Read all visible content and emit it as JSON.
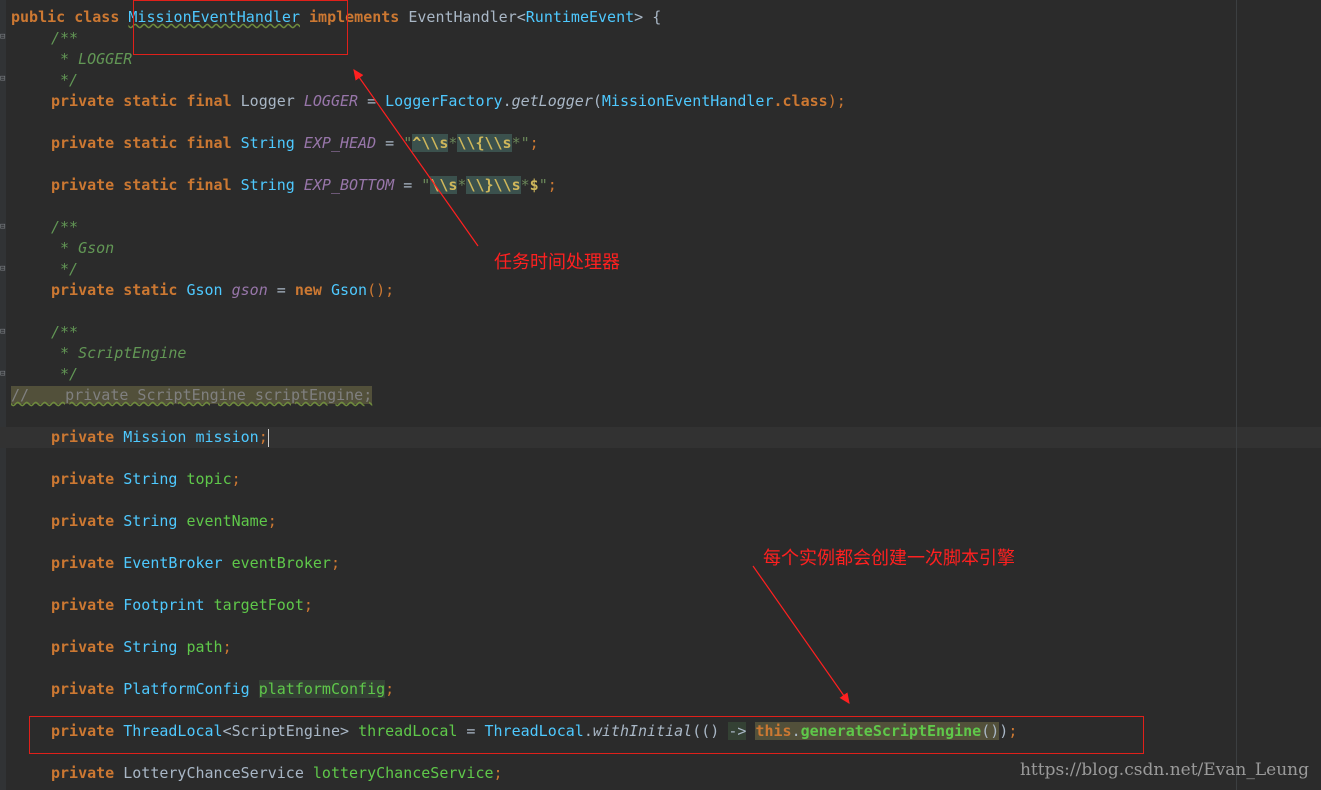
{
  "code": {
    "class_line": {
      "kw": "public class ",
      "name": "MissionEventHandler",
      "mid": " implements ",
      "iface": "EventHandler",
      "lt": "<",
      "generic": "RuntimeEvent",
      "gt": "> {"
    },
    "doc_logger": [
      "/**",
      " * LOGGER",
      " */"
    ],
    "logger_line": {
      "kw": "private static final ",
      "type": "Logger ",
      "field": "LOGGER",
      "eq": " = ",
      "cls": "LoggerFactory",
      "dot": ".",
      "method": "getLogger",
      "open": "(",
      "arg": "MissionEventHandler",
      "suffix": ".class",
      "close": ");"
    },
    "exp_head_line": {
      "kw": "private static final ",
      "type": "String ",
      "field": "EXP_HEAD",
      "eq": " = ",
      "q1": "\"",
      "p1": "^\\\\s",
      "p2": "*",
      "p3": "\\\\{",
      "p4": "\\\\s",
      "p5": "*",
      "q2": "\"",
      "end": ";"
    },
    "exp_bottom_line": {
      "kw": "private static final ",
      "type": "String ",
      "field": "EXP_BOTTOM",
      "eq": " = ",
      "q1": "\"",
      "p1": "\\\\s",
      "p2": "*",
      "p3": "\\\\}",
      "p4": "\\\\s",
      "p5": "*",
      "p6": "$",
      "q2": "\"",
      "end": ";"
    },
    "doc_gson": [
      "/**",
      " * Gson",
      " */"
    ],
    "gson_line": {
      "kw": "private static ",
      "type": "Gson ",
      "field": "gson",
      "eq": " = ",
      "new": "new ",
      "cls": "Gson",
      "end": "();"
    },
    "doc_script": [
      "/**",
      " * ScriptEngine",
      " */"
    ],
    "commented_line": "//    private ScriptEngine scriptEngine;",
    "fields": [
      {
        "kw": "private ",
        "type": "Mission ",
        "name": "mission",
        "end": ";"
      },
      {
        "kw": "private ",
        "type": "String ",
        "name": "topic",
        "end": ";"
      },
      {
        "kw": "private ",
        "type": "String ",
        "name": "eventName",
        "end": ";"
      },
      {
        "kw": "private ",
        "type": "EventBroker ",
        "name": "eventBroker",
        "end": ";"
      },
      {
        "kw": "private ",
        "type": "Footprint ",
        "name": "targetFoot",
        "end": ";"
      },
      {
        "kw": "private ",
        "type": "String ",
        "name": "path",
        "end": ";"
      },
      {
        "kw": "private ",
        "type": "PlatformConfig ",
        "name": "platformConfig",
        "end": ";"
      }
    ],
    "threadlocal_line": {
      "kw": "private ",
      "type": "ThreadLocal",
      "lt": "<",
      "gen": "ScriptEngine",
      "gt": "> ",
      "name": "threadLocal",
      "eq": " = ",
      "cls": "ThreadLocal",
      "dot": ".",
      "method": "withInitial",
      "open": "(() ",
      "arrow": "->",
      "sp": " ",
      "this": "this",
      "dot2": ".",
      "call": "generateScriptEngine",
      "paren": "()",
      "close": ")",
      "semi": ";"
    },
    "lottery_line": {
      "kw": "private ",
      "type": "LotteryChanceService ",
      "name": "lotteryChanceService",
      "end": ";"
    }
  },
  "annotations": {
    "note1": "任务时间处理器",
    "note2": "每个实例都会创建一次脚本引擎"
  },
  "watermark": "https://blog.csdn.net/Evan_Leung",
  "colors": {
    "keyword": "#cc7832",
    "class": "#4ec9ff",
    "annotation": "#ff2020",
    "background": "#2b2b2b"
  }
}
